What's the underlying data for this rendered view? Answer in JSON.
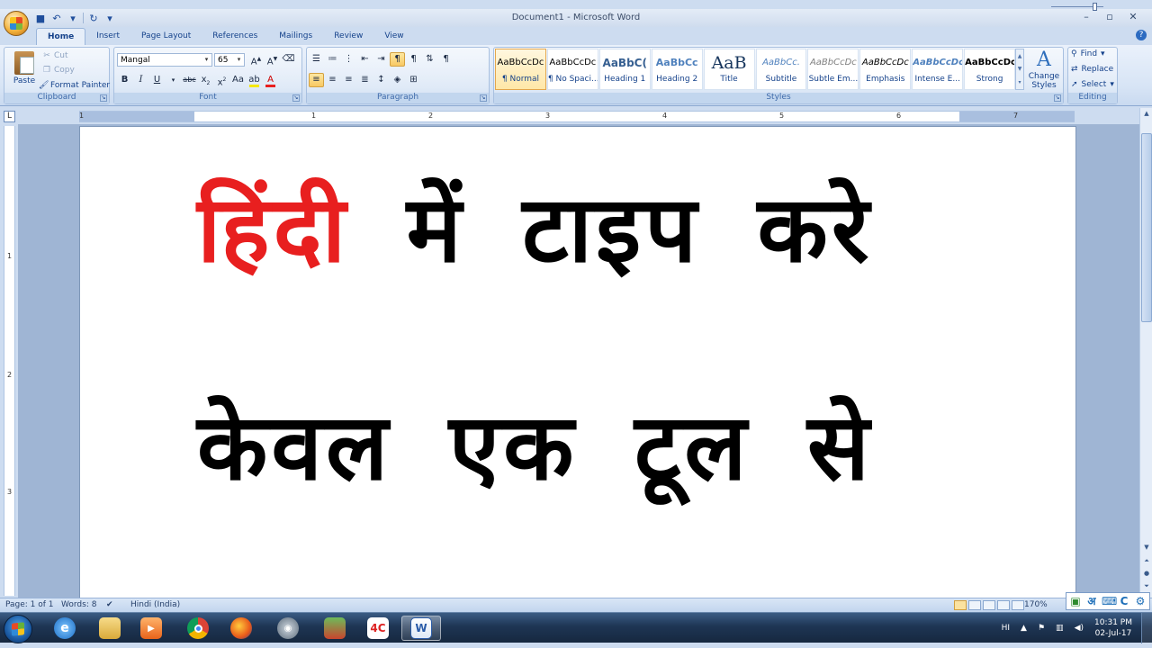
{
  "window": {
    "title": "Document1 - Microsoft Word",
    "minimize": "–",
    "maximize": "▫",
    "close": "✕"
  },
  "tabs": [
    "Home",
    "Insert",
    "Page Layout",
    "References",
    "Mailings",
    "Review",
    "View"
  ],
  "clipboard": {
    "paste": "Paste",
    "cut": "Cut",
    "copy": "Copy",
    "format_painter": "Format Painter",
    "label": "Clipboard"
  },
  "font": {
    "name": "Mangal",
    "size": "65",
    "label": "Font"
  },
  "paragraph": {
    "label": "Paragraph"
  },
  "styles": {
    "items": [
      {
        "preview": "AaBbCcDc",
        "name": "¶ Normal"
      },
      {
        "preview": "AaBbCcDc",
        "name": "¶ No Spaci..."
      },
      {
        "preview": "AaBbC(",
        "name": "Heading 1"
      },
      {
        "preview": "AaBbCc",
        "name": "Heading 2"
      },
      {
        "preview": "AaB",
        "name": "Title"
      },
      {
        "preview": "AaBbCc.",
        "name": "Subtitle"
      },
      {
        "preview": "AaBbCcDc",
        "name": "Subtle Em..."
      },
      {
        "preview": "AaBbCcDc",
        "name": "Emphasis"
      },
      {
        "preview": "AaBbCcDc",
        "name": "Intense E..."
      },
      {
        "preview": "AaBbCcDc",
        "name": "Strong"
      }
    ],
    "change_styles": "Change Styles",
    "label": "Styles"
  },
  "editing": {
    "find": "Find",
    "replace": "Replace",
    "select": "Select",
    "label": "Editing"
  },
  "ruler": {
    "h_numbers": [
      "1",
      "1",
      "2",
      "3",
      "4",
      "5",
      "6",
      "7"
    ],
    "v_numbers": [
      "1",
      "2",
      "3"
    ]
  },
  "document": {
    "line1_red": "हिंदी",
    "line1_rest": "में टाइप करे",
    "line2": "केवल एक टूल से"
  },
  "status": {
    "page": "Page: 1 of 1",
    "words": "Words: 8",
    "language": "Hindi (India)",
    "zoom": "170%"
  },
  "ime": {
    "hindi_glyph": "अ",
    "c_glyph": "C"
  },
  "taskbar": {
    "lang": "HI",
    "time": "10:31 PM",
    "date": "02-Jul-17"
  },
  "colors": {
    "accent_red": "#e81f1f",
    "ribbon": "#d7e4f5"
  }
}
